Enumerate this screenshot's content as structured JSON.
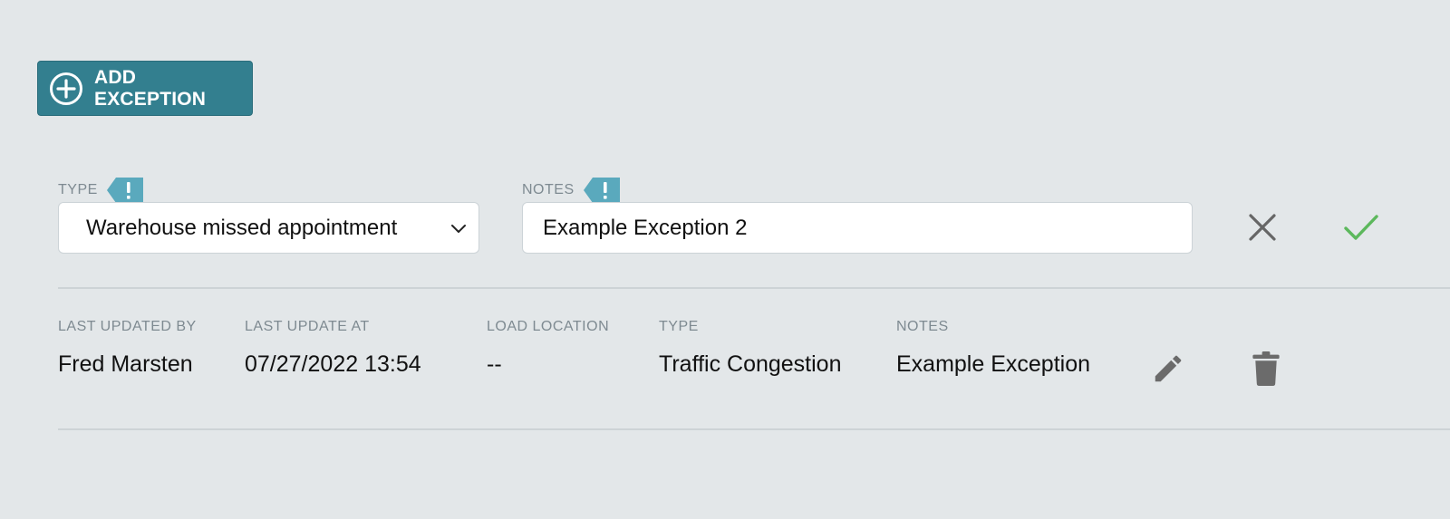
{
  "toolbar": {
    "add_label": "ADD EXCEPTION",
    "add_icon": "plus-circle-icon"
  },
  "form": {
    "type_label": "TYPE",
    "type_value": "Warehouse missed appointment",
    "notes_label": "NOTES",
    "notes_value": "Example Exception 2",
    "required_icon": "exclamation-tag-icon",
    "cancel_icon": "close-icon",
    "confirm_icon": "check-icon"
  },
  "exception": {
    "headers": {
      "last_updated_by": "LAST UPDATED BY",
      "last_update_at": "LAST UPDATE AT",
      "load_location": "LOAD LOCATION",
      "type": "TYPE",
      "notes": "NOTES"
    },
    "values": {
      "last_updated_by": "Fred Marsten",
      "last_update_at": "07/27/2022 13:54",
      "load_location": "--",
      "type": "Traffic Congestion",
      "notes": "Example Exception"
    },
    "edit_icon": "pencil-icon",
    "delete_icon": "trash-icon"
  },
  "colors": {
    "background": "#e3e7e9",
    "primary_button": "#337f8f",
    "required_tag": "#5aa9bd",
    "confirm": "#5cb85c",
    "muted_label": "#7e8a91"
  }
}
